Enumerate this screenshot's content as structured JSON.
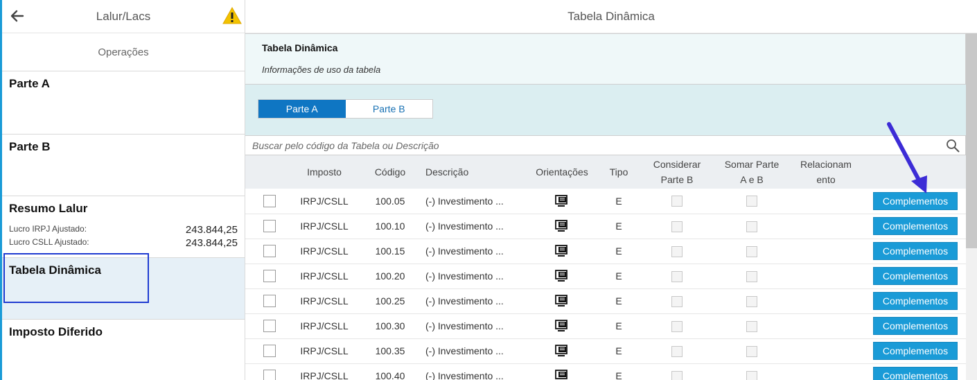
{
  "sidebar": {
    "title": "Lalur/Lacs",
    "operations": "Operações",
    "items": [
      {
        "title": "Parte A"
      },
      {
        "title": "Parte B"
      },
      {
        "title": "Resumo Lalur",
        "lines": [
          {
            "label": "Lucro IRPJ Ajustado:",
            "value": "243.844,25"
          },
          {
            "label": "Lucro CSLL Ajustado:",
            "value": "243.844,25"
          }
        ]
      },
      {
        "title": "Tabela Dinâmica"
      },
      {
        "title": "Imposto Diferido"
      }
    ]
  },
  "main": {
    "title": "Tabela Dinâmica",
    "info": {
      "title": "Tabela Dinâmica",
      "subtitle": "Informações de uso da tabela"
    },
    "tabs": [
      {
        "label": "Parte A"
      },
      {
        "label": "Parte B"
      }
    ],
    "search": {
      "placeholder": "Buscar pelo código da Tabela ou Descrição"
    },
    "table": {
      "headers": {
        "imposto": "Imposto",
        "codigo": "Código",
        "descricao": "Descrição",
        "orientacoes": "Orientações",
        "tipo": "Tipo",
        "considerar_1": "Considerar",
        "considerar_2": "Parte B",
        "somar_1": "Somar Parte",
        "somar_2": "A e B",
        "relac_1": "Relacionam",
        "relac_2": "ento"
      },
      "button_label": "Complementos",
      "rows": [
        {
          "imposto": "IRPJ/CSLL",
          "codigo": "100.05",
          "descricao": "(-) Investimento ...",
          "tipo": "E"
        },
        {
          "imposto": "IRPJ/CSLL",
          "codigo": "100.10",
          "descricao": "(-) Investimento ...",
          "tipo": "E"
        },
        {
          "imposto": "IRPJ/CSLL",
          "codigo": "100.15",
          "descricao": "(-) Investimento ...",
          "tipo": "E"
        },
        {
          "imposto": "IRPJ/CSLL",
          "codigo": "100.20",
          "descricao": "(-) Investimento ...",
          "tipo": "E"
        },
        {
          "imposto": "IRPJ/CSLL",
          "codigo": "100.25",
          "descricao": "(-) Investimento ...",
          "tipo": "E"
        },
        {
          "imposto": "IRPJ/CSLL",
          "codigo": "100.30",
          "descricao": "(-) Investimento ...",
          "tipo": "E"
        },
        {
          "imposto": "IRPJ/CSLL",
          "codigo": "100.35",
          "descricao": "(-) Investimento ...",
          "tipo": "E"
        },
        {
          "imposto": "IRPJ/CSLL",
          "codigo": "100.40",
          "descricao": "(-) Investimento ...",
          "tipo": "E"
        }
      ]
    }
  },
  "colors": {
    "accent": "#1a9bd7",
    "tab_active": "#0f76c3",
    "annotation": "#1f3bd1"
  },
  "icons": {
    "back": "arrow-left-icon",
    "warning": "warning-triangle-icon",
    "search": "search-icon",
    "orientation": "monitor-document-icon"
  }
}
